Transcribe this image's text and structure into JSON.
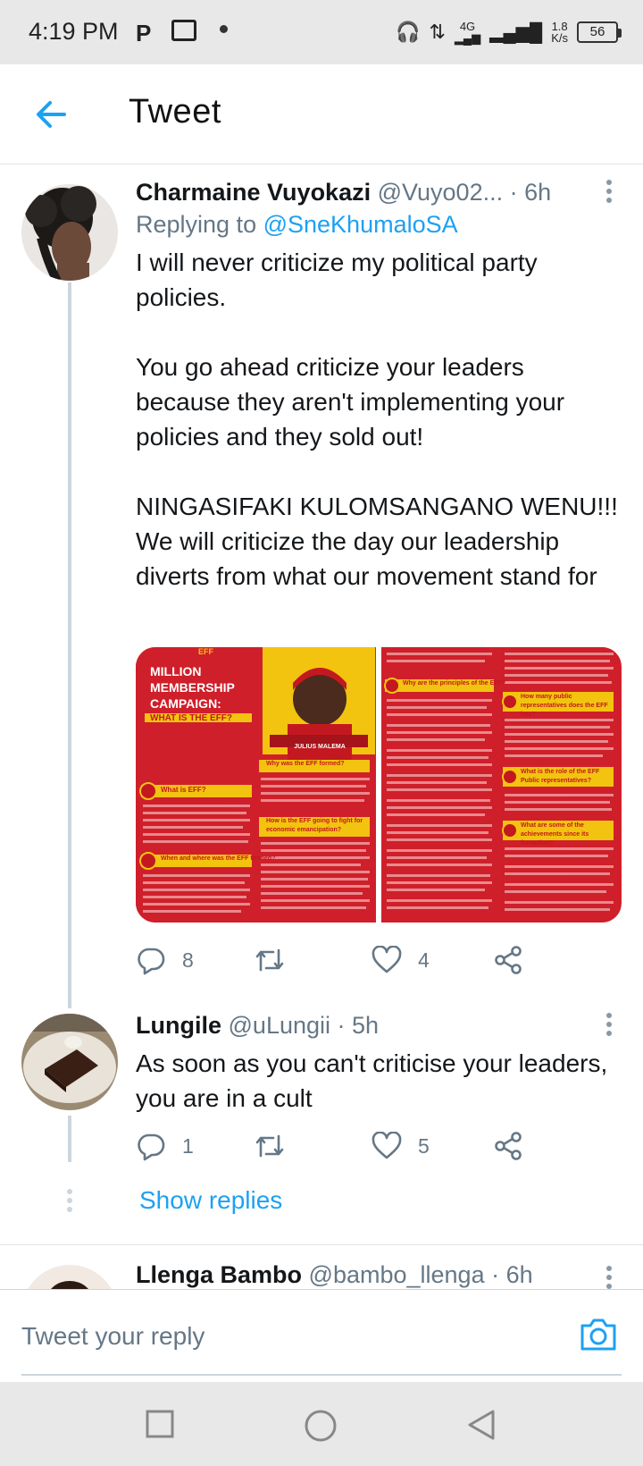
{
  "status_bar": {
    "time": "4:19 PM",
    "p_icon_label": "P",
    "network": "4G",
    "speed_value": "1.8",
    "speed_unit": "K/s",
    "battery": "56"
  },
  "header": {
    "title": "Tweet",
    "back_icon": "arrow-left-icon",
    "accent_color": "#1da1f2"
  },
  "tweets": [
    {
      "name": "Charmaine Vuyokazi",
      "handle": "@Vuyo02...",
      "time": "· 6h",
      "replying_prefix": "Replying to ",
      "replying_to": "@SneKhumaloSA",
      "paragraphs": [
        "I will never criticize my political party policies.",
        "You go ahead criticize your leaders because they aren't implementing your policies and they sold out!",
        "NINGASIFAKI KULOMSANGANO WENU!!! We will criticize the day our leadership diverts from what our movement stand for"
      ],
      "media": {
        "poster1": {
          "brand": "EFF",
          "title_lines": [
            "MILLION",
            "MEMBERSHIP",
            "CAMPAIGN:"
          ],
          "subtitle": "WHAT IS THE EFF?",
          "leader_name": "JULIUS MALEMA",
          "q1": "What is EFF?",
          "q2": "When and where was the EFF formed?",
          "q3": "Why was the EFF formed?",
          "q4": "How is the EFF going to fight for economic emancipation?"
        },
        "poster2": {
          "q5": "Why are the principles of the EFF?",
          "q7": "How many public representatives does the EFF has?",
          "q8": "What is the role of the EFF Public representatives?",
          "q9": "What are some of the achievements since its formation?"
        }
      },
      "replies": "8",
      "retweets": "",
      "likes": "4"
    },
    {
      "name": "Lungile",
      "handle": "@uLungii",
      "time": "· 5h",
      "text": "As soon as you can't criticise your leaders, you are in a cult",
      "replies": "1",
      "retweets": "",
      "likes": "5"
    },
    {
      "name": "Llenga Bambo",
      "handle": "@bambo_llenga",
      "time": "· 6h"
    }
  ],
  "show_replies": "Show replies",
  "composer": {
    "placeholder": "Tweet your reply",
    "camera_icon": "camera-icon"
  },
  "nav": {
    "recents_icon": "square-icon",
    "home_icon": "circle-icon",
    "back_icon": "triangle-back-icon"
  }
}
